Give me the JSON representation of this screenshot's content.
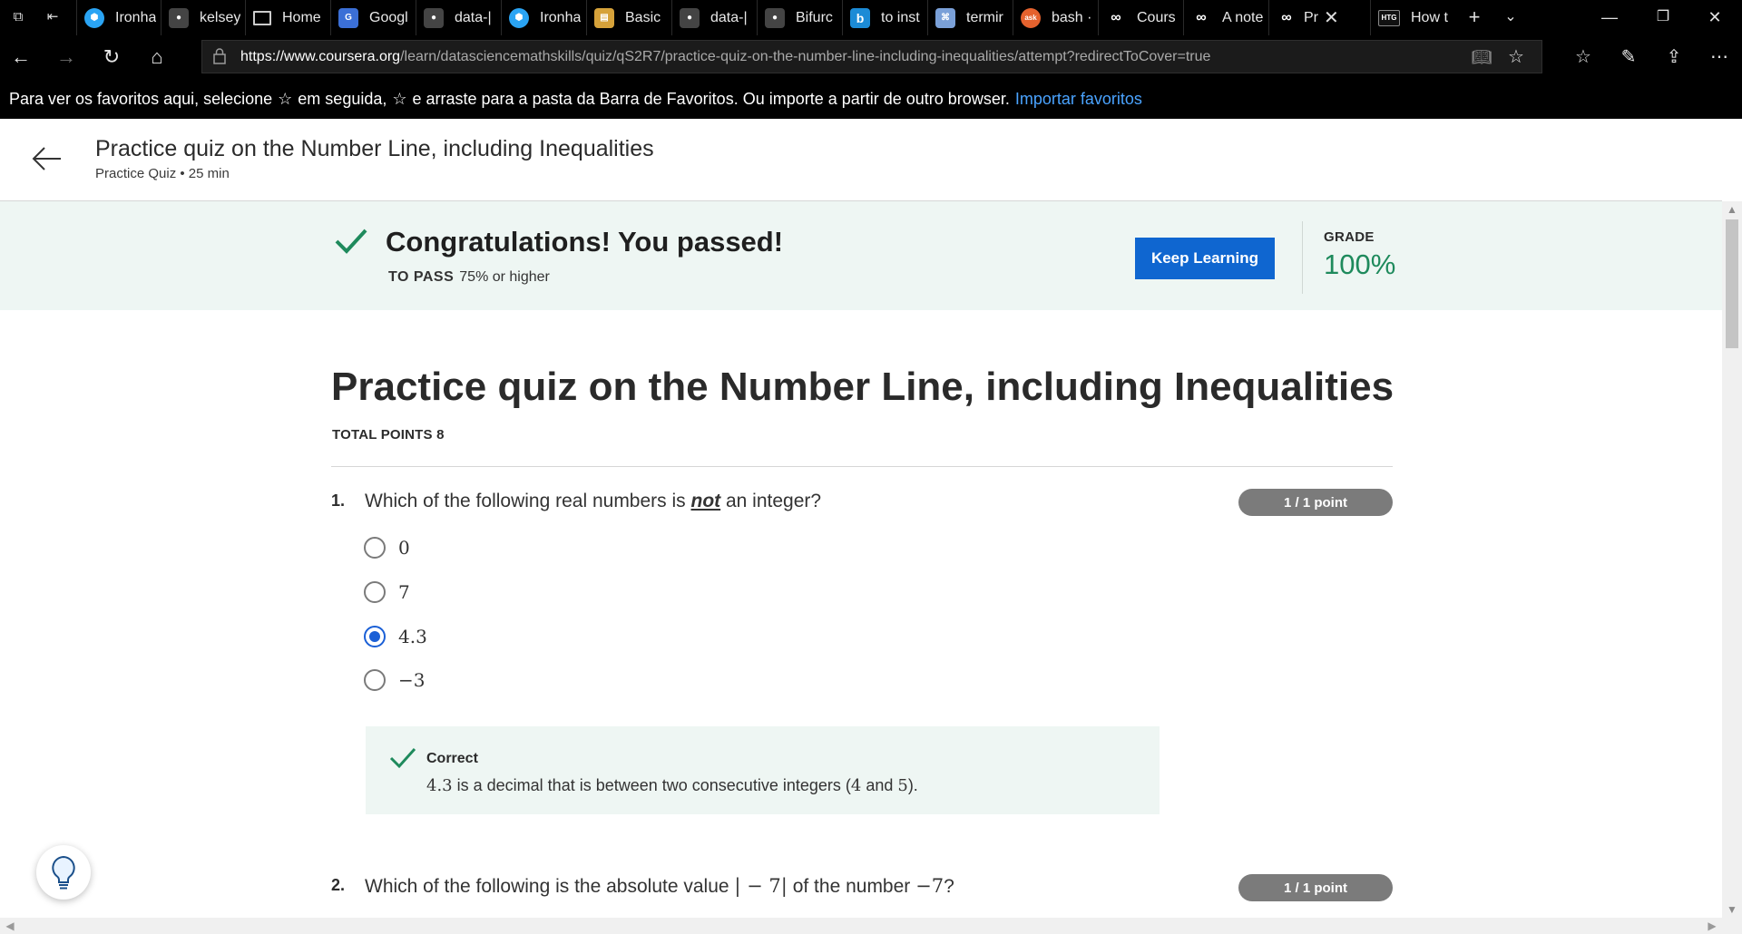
{
  "browser": {
    "tabs": [
      {
        "title": "Ironha",
        "icon": "ironhack-icon",
        "color": "#2aa4f4"
      },
      {
        "title": "kelsey",
        "icon": "github-icon",
        "color": "#444444"
      },
      {
        "title": "Home",
        "icon": "page-icon",
        "color": "#000000"
      },
      {
        "title": "Googl",
        "icon": "google-docs-icon",
        "color": "#3b6fd6"
      },
      {
        "title": "data-|",
        "icon": "github-icon",
        "color": "#444444"
      },
      {
        "title": "Ironha",
        "icon": "ironhack-icon",
        "color": "#2aa4f4"
      },
      {
        "title": "Basic",
        "icon": "book-icon",
        "color": "#d6a23a"
      },
      {
        "title": "data-|",
        "icon": "github-icon",
        "color": "#444444"
      },
      {
        "title": "Bifurc",
        "icon": "github-icon",
        "color": "#444444"
      },
      {
        "title": "to inst",
        "icon": "bing-icon",
        "color": "#1c8bd6"
      },
      {
        "title": "termir",
        "icon": "terminal-icon",
        "color": "#7aa0d8"
      },
      {
        "title": "bash ·",
        "icon": "askubuntu-icon",
        "color": "#e5622e"
      },
      {
        "title": "Cours",
        "icon": "coursera-icon",
        "color": "#000000"
      },
      {
        "title": "A note",
        "icon": "coursera-icon",
        "color": "#000000"
      },
      {
        "title": "Pr",
        "icon": "coursera-icon",
        "color": "#000000"
      },
      {
        "title": "How t",
        "icon": "htg-icon",
        "color": "#111111"
      }
    ],
    "htg_badge": "HTG",
    "ask_badge": "ask",
    "url_host": "https://www.coursera.org",
    "url_path": "/learn/datasciencemathskills/quiz/qS2R7/practice-quiz-on-the-number-line-including-inequalities/attempt?redirectToCover=true",
    "favorites_message": "Para ver os favoritos aqui, selecione",
    "favorites_message_2": "em seguida,",
    "favorites_message_3": "e arraste para a pasta da Barra de Favoritos. Ou importe a partir de outro browser.",
    "favorites_import_link": "Importar favoritos"
  },
  "header": {
    "title": "Practice quiz on the Number Line, including Inequalities",
    "subtitle": "Practice Quiz • 25 min"
  },
  "result": {
    "message": "Congratulations! You passed!",
    "to_pass_label": "TO PASS",
    "to_pass_value": "75% or higher",
    "keep_learning_label": "Keep Learning",
    "grade_label": "GRADE",
    "grade_value": "100%",
    "success_color": "#1e8a5c"
  },
  "quiz": {
    "title": "Practice quiz on the Number Line, including Inequalities",
    "total_points": "TOTAL POINTS 8",
    "questions": [
      {
        "number": "1.",
        "text_before": "Which of the following real numbers is ",
        "text_emphasis": "not",
        "text_after": " an integer?",
        "points": "1 / 1 point",
        "options": [
          "0",
          "7",
          "4.3",
          "−3"
        ],
        "selected": "4.3",
        "feedback_label": "Correct",
        "feedback_m1": "4.3",
        "feedback_t1": " is a decimal that is between two consecutive integers (",
        "feedback_m2": "4",
        "feedback_t2": " and ",
        "feedback_m3": "5",
        "feedback_t3": ")."
      },
      {
        "number": "2.",
        "text_before": "Which of the following is the absolute value ",
        "text_math": "| − 7|",
        "text_middle": " of the number ",
        "text_math2": "−7",
        "text_after": "?",
        "points": "1 / 1 point"
      }
    ]
  }
}
